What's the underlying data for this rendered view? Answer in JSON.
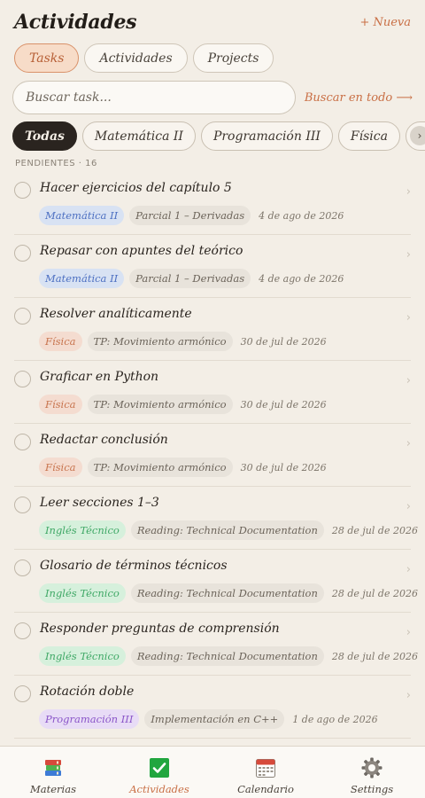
{
  "header": {
    "title": "Actividades",
    "new_label": "+ Nueva"
  },
  "segments": [
    {
      "label": "Tasks",
      "active": true
    },
    {
      "label": "Actividades",
      "active": false
    },
    {
      "label": "Projects",
      "active": false
    }
  ],
  "search": {
    "placeholder": "Buscar task...",
    "value": "",
    "search_all_label": "Buscar en todo ⟶"
  },
  "filters": [
    {
      "label": "Todas",
      "active": true
    },
    {
      "label": "Matemática II",
      "active": false
    },
    {
      "label": "Programación III",
      "active": false
    },
    {
      "label": "Física",
      "active": false
    },
    {
      "label": "Inglés Técnico",
      "active": false
    }
  ],
  "filters_scroll_icon": "chevron-right-icon",
  "section": {
    "label": "PENDIENTES · 16"
  },
  "tasks": [
    {
      "title": "Hacer ejercicios del capítulo 5",
      "subject": "Matemática II",
      "subject_color": "#4d70c2",
      "context": "Parcial 1 – Derivadas",
      "date": "4 de ago de 2026"
    },
    {
      "title": "Repasar con apuntes del teórico",
      "subject": "Matemática II",
      "subject_color": "#4d70c2",
      "context": "Parcial 1 – Derivadas",
      "date": "4 de ago de 2026"
    },
    {
      "title": "Resolver analíticamente",
      "subject": "Física",
      "subject_color": "#c8754f",
      "context": "TP: Movimiento armónico",
      "date": "30 de jul de 2026"
    },
    {
      "title": "Graficar en Python",
      "subject": "Física",
      "subject_color": "#c8754f",
      "context": "TP: Movimiento armónico",
      "date": "30 de jul de 2026"
    },
    {
      "title": "Redactar conclusión",
      "subject": "Física",
      "subject_color": "#c8754f",
      "context": "TP: Movimiento armónico",
      "date": "30 de jul de 2026"
    },
    {
      "title": "Leer secciones 1–3",
      "subject": "Inglés Técnico",
      "subject_color": "#3fa866",
      "context": "Reading: Technical Documentation",
      "date": "28 de jul de 2026"
    },
    {
      "title": "Glosario de términos técnicos",
      "subject": "Inglés Técnico",
      "subject_color": "#3fa866",
      "context": "Reading: Technical Documentation",
      "date": "28 de jul de 2026"
    },
    {
      "title": "Responder preguntas de comprensión",
      "subject": "Inglés Técnico",
      "subject_color": "#3fa866",
      "context": "Reading: Technical Documentation",
      "date": "28 de jul de 2026"
    },
    {
      "title": "Rotación doble",
      "subject": "Programación III",
      "subject_color": "#8a55c8",
      "context": "Implementación en C++",
      "date": "1 de ago de 2026"
    }
  ],
  "nav": [
    {
      "label": "Materias",
      "icon": "books-icon",
      "active": false
    },
    {
      "label": "Actividades",
      "icon": "checkbox-icon",
      "active": true
    },
    {
      "label": "Calendario",
      "icon": "calendar-icon",
      "active": false
    },
    {
      "label": "Settings",
      "icon": "gear-icon",
      "active": false
    }
  ],
  "colors": {
    "accent": "#c96f45",
    "background": "#f3eee6",
    "active_chip": "#2a241f",
    "active_segment_bg": "#f7dcc8"
  }
}
